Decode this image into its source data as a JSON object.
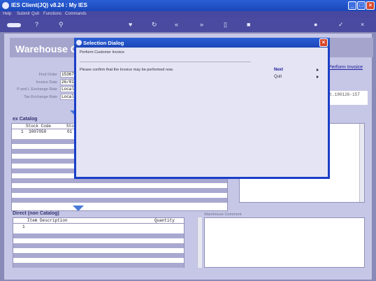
{
  "window": {
    "title": "IES Client(JQ) v8.24 : My IES"
  },
  "menu": [
    "Help",
    "Submit",
    "Quit",
    "Functions",
    "Commands"
  ],
  "page": {
    "banner": "Warehouse Or",
    "perform_link": "Perform Invoice",
    "fields": [
      {
        "label": "Find Order",
        "value": "153674"
      },
      {
        "label": "Invoice Date",
        "value": "26/01/"
      },
      {
        "label": "P and L Exchange Rate",
        "value": "Local"
      },
      {
        "label": "Tax Exchange Rate",
        "value": "Local"
      }
    ],
    "right_field": "ct.180126-157",
    "catalog": {
      "title": "ex Catalog",
      "columns": [
        "Stock Code",
        "Stor"
      ],
      "rows": [
        {
          "num": "1",
          "code": "3007058",
          "store": "01"
        }
      ]
    },
    "non_catalog": {
      "title": "Direct (non Catalog)",
      "columns": [
        "Item Description",
        "Quantity"
      ],
      "rows": [
        {
          "num": "1"
        }
      ]
    },
    "warehouse_comment_label": "Warehouse Comment"
  },
  "dialog": {
    "title": "Selection Dialog",
    "heading": "Perform Customer Invoice",
    "message": "Please confirm that the Invoice may be performed now.",
    "options": [
      "Next",
      "Quit"
    ]
  }
}
